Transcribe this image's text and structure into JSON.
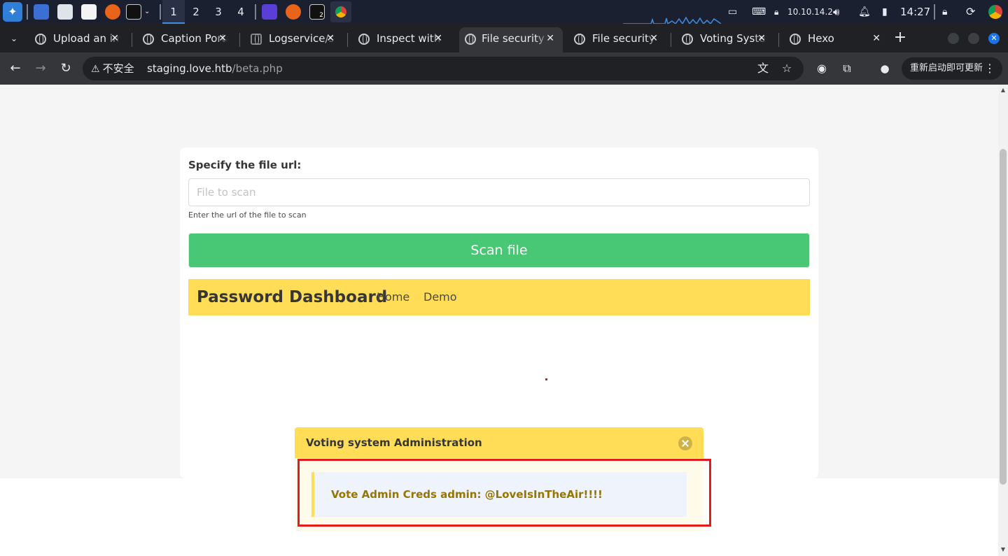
{
  "taskbar": {
    "workspaces": [
      "1",
      "2",
      "3",
      "4"
    ],
    "ip": "10.10.14.2",
    "clock": "14:27",
    "terminal_badge": "2"
  },
  "browser": {
    "tabs": [
      {
        "title": "Upload an image",
        "active": false
      },
      {
        "title": "Caption Portal",
        "active": false
      },
      {
        "title": "Logservice/s",
        "active": false
      },
      {
        "title": "Inspect with",
        "active": false
      },
      {
        "title": "File security",
        "active": true
      },
      {
        "title": "File security",
        "active": false
      },
      {
        "title": "Voting System",
        "active": false
      },
      {
        "title": "Hexo",
        "active": false
      }
    ],
    "new_tab": "+",
    "security_label": "不安全",
    "url_host": "staging.love.htb",
    "url_path": "/beta.php",
    "update_button": "重新启动即可更新"
  },
  "page": {
    "form_label": "Specify the file url:",
    "input_placeholder": "File to scan",
    "input_value": "",
    "help_text": "Enter the url of the file to scan",
    "scan_button": "Scan file",
    "navbar": {
      "brand": "Password Dashboard",
      "items": [
        "Home",
        "Demo"
      ]
    },
    "message": {
      "title": "Voting system Administration",
      "body": "Vote Admin Creds admin: @LoveIsInTheAir!!!!"
    }
  },
  "colors": {
    "accent_green": "#48c774",
    "navbar_yellow": "#ffdd57",
    "message_text": "#947600",
    "highlight_red": "#e31b1b"
  }
}
